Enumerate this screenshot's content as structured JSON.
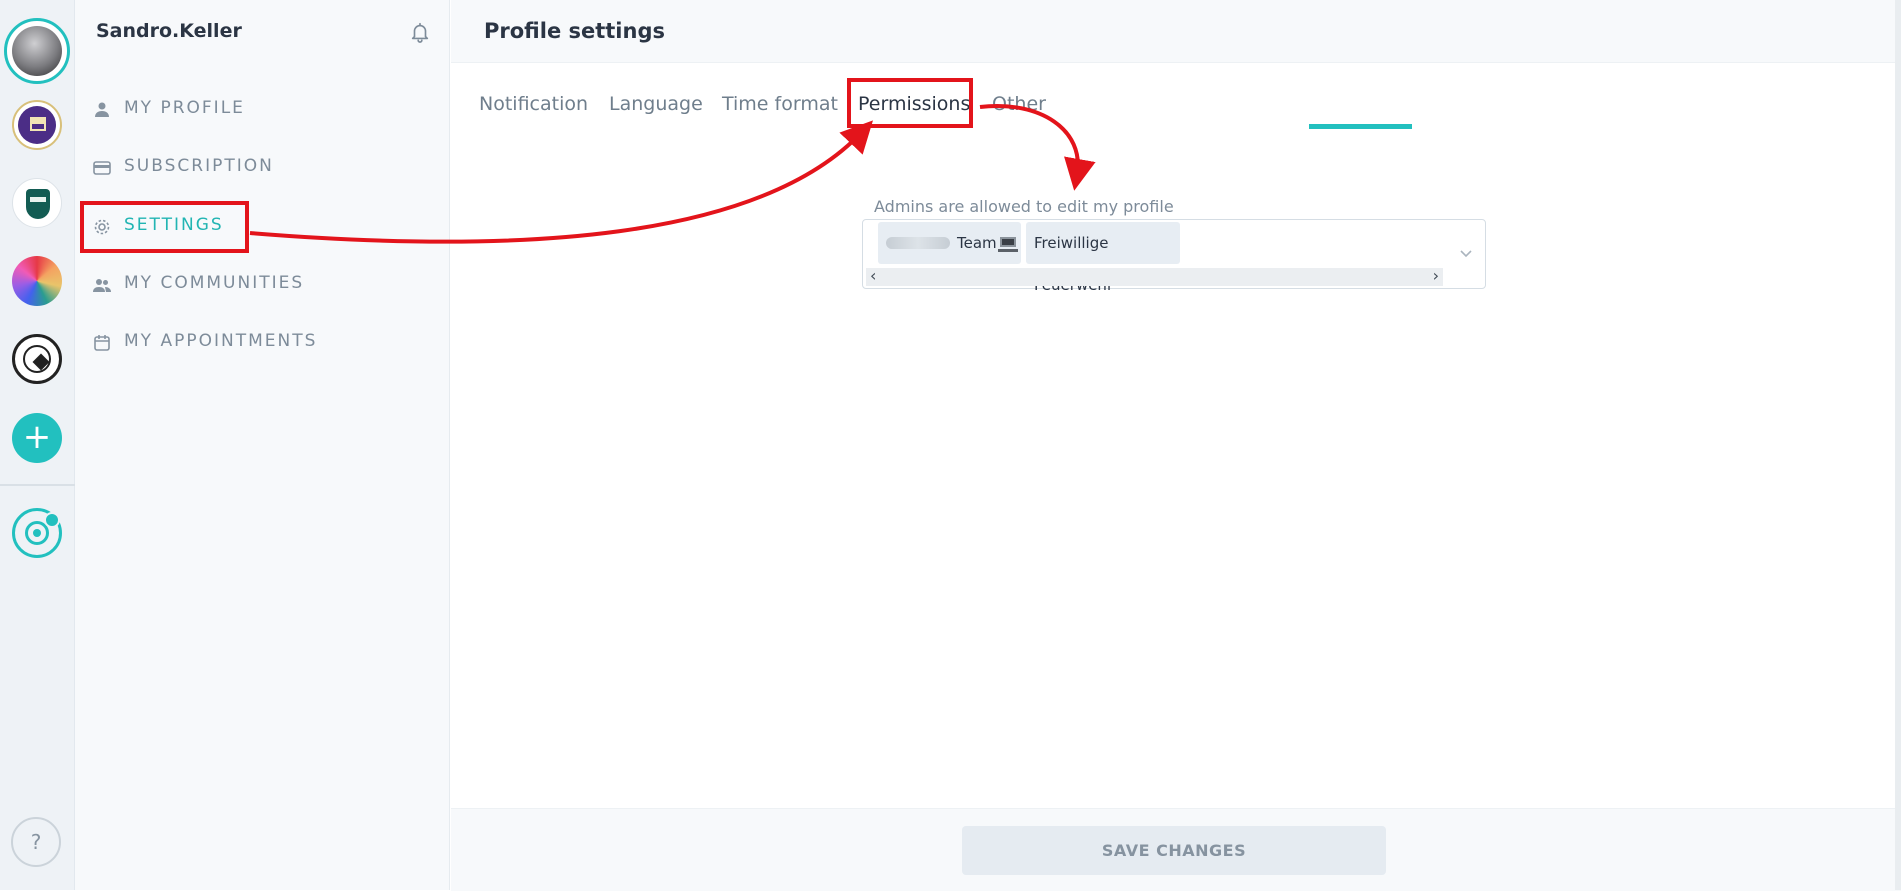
{
  "user": {
    "username": "Sandro.Keller"
  },
  "sidebar": {
    "items": [
      {
        "id": "profile",
        "label": "MY PROFILE",
        "icon": "person-icon"
      },
      {
        "id": "subscription",
        "label": "SUBSCRIPTION",
        "icon": "credit-card-icon"
      },
      {
        "id": "settings",
        "label": "SETTINGS",
        "icon": "gear-icon",
        "active": true
      },
      {
        "id": "communities",
        "label": "MY COMMUNITIES",
        "icon": "people-icon"
      },
      {
        "id": "appointments",
        "label": "MY APPOINTMENTS",
        "icon": "calendar-icon"
      }
    ]
  },
  "rail": {
    "add_label": "+",
    "help_label": "?"
  },
  "main": {
    "title": "Profile settings",
    "tabs": [
      {
        "label": "Notification"
      },
      {
        "label": "Language"
      },
      {
        "label": "Time format"
      },
      {
        "label": "Permissions",
        "active": true
      },
      {
        "label": "Other"
      }
    ],
    "permissions": {
      "label": "Admins are allowed to edit my profile",
      "selected": [
        {
          "text": "Team",
          "icon": "laptop-icon"
        },
        {
          "text": "Freiwillige Feuerwehr"
        }
      ]
    },
    "save_label": "SAVE CHANGES"
  },
  "colors": {
    "accent": "#22c0bf",
    "annotation": "#e3141b",
    "text": "#2b3544",
    "muted": "#7d8b99"
  }
}
